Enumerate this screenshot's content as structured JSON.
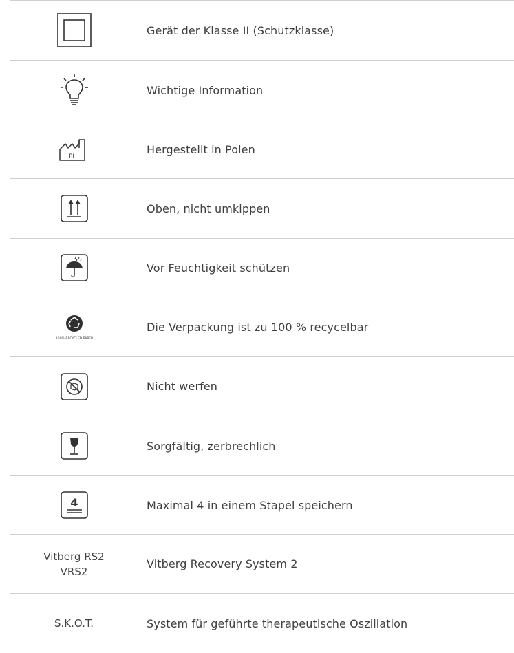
{
  "rows": [
    {
      "icon": "class-ii-double-square-icon",
      "text": "Gerät der Klasse II (Schutzklasse)"
    },
    {
      "icon": "lightbulb-icon",
      "text": "Wichtige Information"
    },
    {
      "icon": "factory-pl-icon",
      "text": "Hergestellt in Polen",
      "icon_label": "PL"
    },
    {
      "icon": "this-way-up-arrows-icon",
      "text": "Oben, nicht umkippen"
    },
    {
      "icon": "umbrella-rain-icon",
      "text": "Vor Feuchtigkeit schützen"
    },
    {
      "icon": "recycle-100-icon",
      "text": "Die Verpackung ist zu 100 % recycelbar",
      "icon_label": "100% RECYCLED PAPER"
    },
    {
      "icon": "do-not-throw-icon",
      "text": "Nicht werfen"
    },
    {
      "icon": "fragile-glass-icon",
      "text": "Sorgfältig, zerbrechlich"
    },
    {
      "icon": "stack-limit-icon",
      "text": "Maximal 4 in einem Stapel speichern",
      "icon_label": "4"
    },
    {
      "symbol_line1": "Vitberg RS2",
      "symbol_line2": "VRS2",
      "text": "Vitberg Recovery System 2"
    },
    {
      "symbol_line1": "S.K.O.T.",
      "text": "System für geführte therapeutische Oszillation"
    }
  ]
}
